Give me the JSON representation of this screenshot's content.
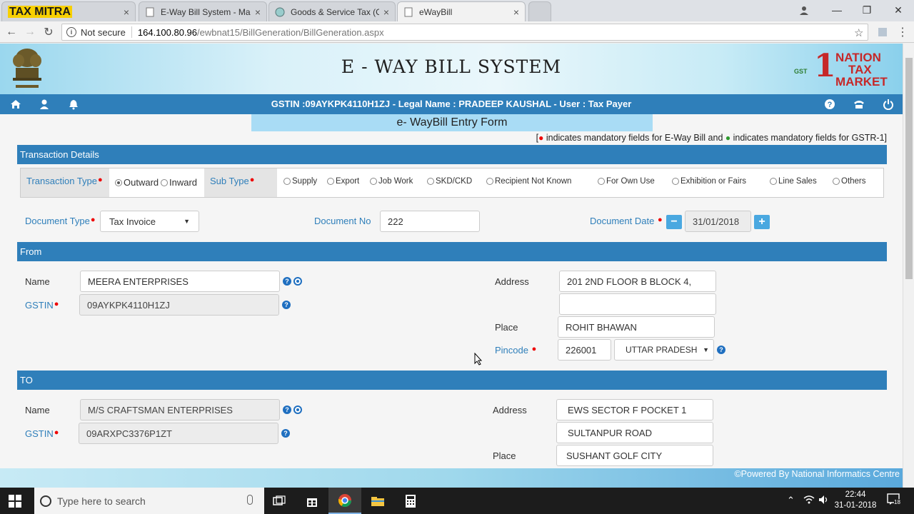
{
  "browser": {
    "tabs": [
      {
        "title": "TAX MITRA",
        "kind": "logo"
      },
      {
        "title": "E-Way Bill System - Main",
        "kind": "doc"
      },
      {
        "title": "Goods & Service Tax (GS",
        "kind": "globe"
      },
      {
        "title": "eWayBill",
        "kind": "doc"
      }
    ],
    "close_glyph": "×",
    "not_secure": "Not secure",
    "url_host": "164.100.80.96",
    "url_path": "/ewbnat15/BillGeneration/BillGeneration.aspx"
  },
  "header": {
    "title": "E - WAY BILL SYSTEM",
    "brand_line1": "NATION",
    "brand_line2": "TAX",
    "brand_line3": "MARKET",
    "brand_big": "1",
    "brand_gst": "GST",
    "user_line": "GSTIN :09AYKPK4110H1ZJ - Legal Name : PRADEEP KAUSHAL - User : Tax Payer"
  },
  "form": {
    "title": "e- WayBill Entry Form",
    "mand_note_1": "[",
    "mand_note_2": "indicates mandatory fields for E-Way Bill and",
    "mand_note_3": "indicates mandatory fields for GSTR-1]",
    "transaction": {
      "section_title": "Transaction Details",
      "type_label": "Transaction Type",
      "type_options": [
        "Outward",
        "Inward"
      ],
      "type_selected": "Outward",
      "subtype_label": "Sub Type",
      "subtype_options": [
        "Supply",
        "Export",
        "Job Work",
        "SKD/CKD",
        "Recipient Not Known",
        "For Own Use",
        "Exhibition or Fairs",
        "Line Sales",
        "Others"
      ]
    },
    "document": {
      "type_label": "Document Type",
      "type_value": "Tax Invoice",
      "no_label": "Document No",
      "no_value": "222",
      "date_label": "Document Date",
      "date_value": "31/01/2018",
      "minus": "−",
      "plus": "+"
    },
    "from": {
      "section_title": "From",
      "name_label": "Name",
      "name_value": "MEERA ENTERPRISES",
      "gstin_label": "GSTIN",
      "gstin_value": "09AYKPK4110H1ZJ",
      "address_label": "Address",
      "address_line1": "201 2ND FLOOR B BLOCK 4,",
      "address_line2": "",
      "place_label": "Place",
      "place_value": "ROHIT BHAWAN",
      "pincode_label": "Pincode",
      "pincode_value": "226001",
      "state_value": "UTTAR PRADESH"
    },
    "to": {
      "section_title": "TO",
      "name_label": "Name",
      "name_value": "M/S  CRAFTSMAN ENTERPRISES",
      "gstin_label": "GSTIN",
      "gstin_value": "09ARXPC3376P1ZT",
      "address_label": "Address",
      "address_line1": "EWS SECTOR F POCKET 1",
      "address_line2": "SULTANPUR ROAD",
      "place_label": "Place",
      "place_value": "SUSHANT GOLF CITY"
    },
    "help_glyph": "?"
  },
  "footer": {
    "powered": "©Powered By National Informatics Centre"
  },
  "taskbar": {
    "search_placeholder": "Type here to search",
    "time": "22:44",
    "date": "31-01-2018",
    "notif_count": "18"
  },
  "colors": {
    "primary_blue": "#2f7fba",
    "required_red": "#e00000",
    "gstr_green": "#2e9a2e"
  }
}
